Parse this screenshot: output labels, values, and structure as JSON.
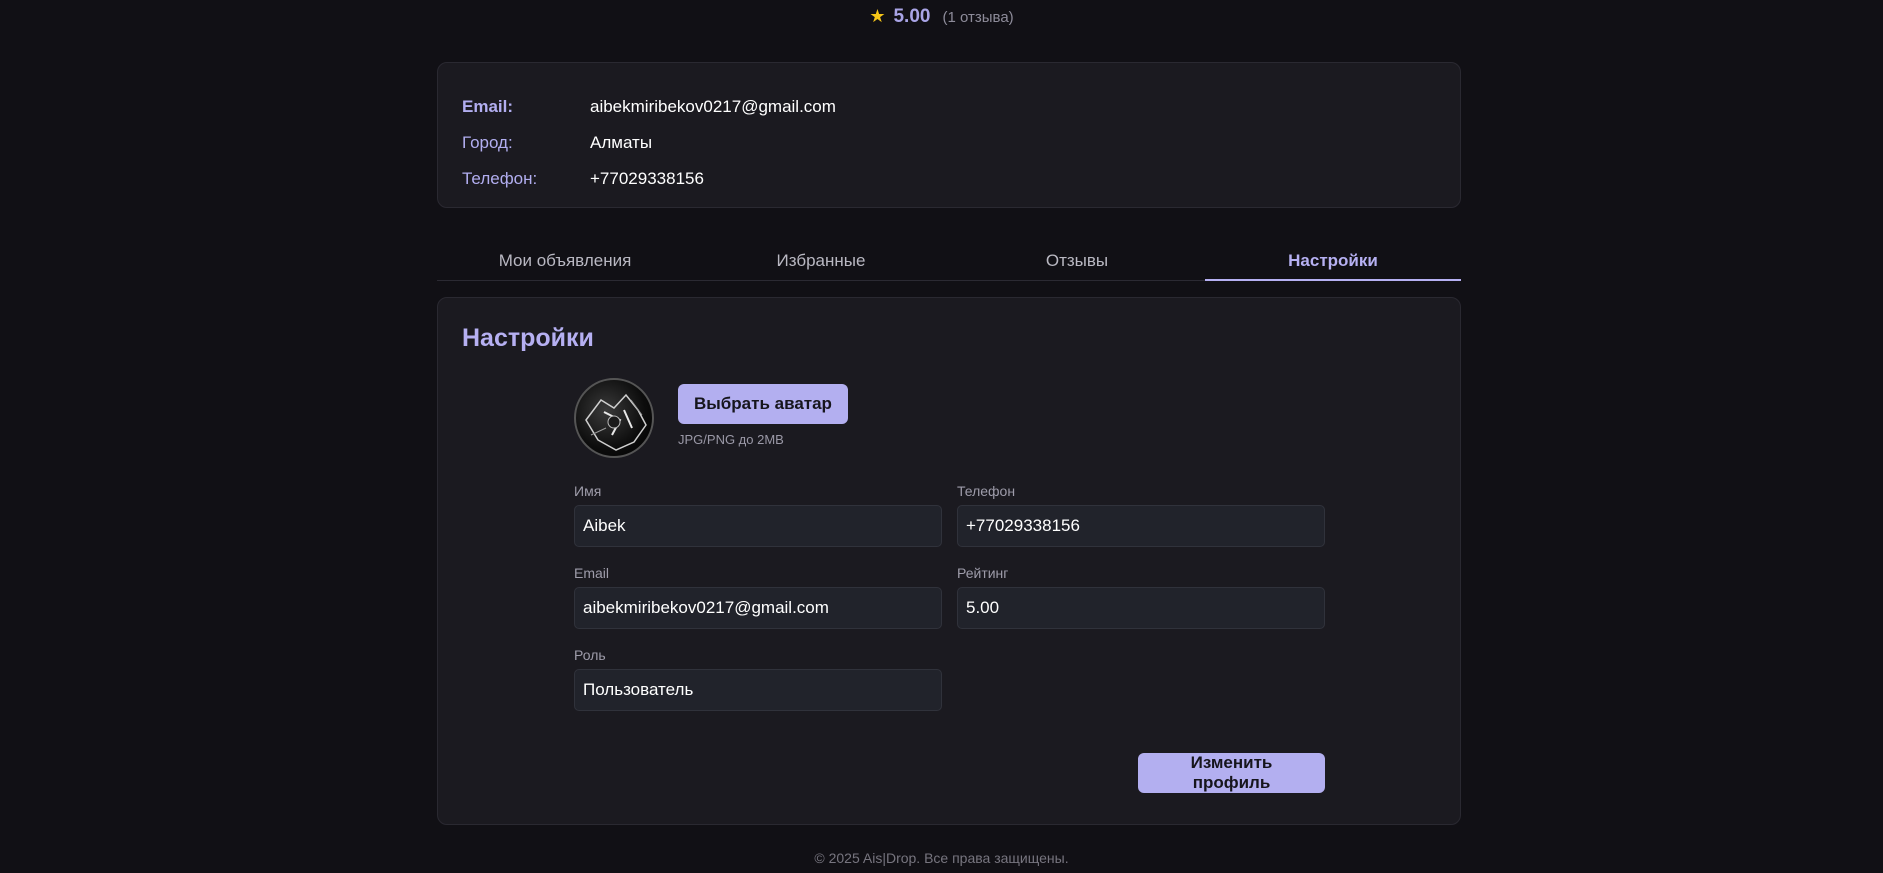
{
  "rating": {
    "star": "★",
    "value": "5.00",
    "count": "(1 отзыва)"
  },
  "info": [
    {
      "label": "Email:",
      "value": "aibekmiribekov0217@gmail.com"
    },
    {
      "label": "Город:",
      "value": "Алматы"
    },
    {
      "label": "Телефон:",
      "value": "+77029338156"
    }
  ],
  "tabs": [
    {
      "label": "Мои объявления",
      "active": false
    },
    {
      "label": "Избранные",
      "active": false
    },
    {
      "label": "Отзывы",
      "active": false
    },
    {
      "label": "Настройки",
      "active": true
    }
  ],
  "settings": {
    "title": "Настройки",
    "avatar_button": "Выбрать аватар",
    "avatar_hint": "JPG/PNG до 2MB",
    "fields": {
      "name": {
        "label": "Имя",
        "value": "Aibek"
      },
      "phone": {
        "label": "Телефон",
        "value": "+77029338156"
      },
      "email": {
        "label": "Email",
        "value": "aibekmiribekov0217@gmail.com"
      },
      "rating": {
        "label": "Рейтинг",
        "value": "5.00"
      },
      "role": {
        "label": "Роль",
        "value": "Пользователь"
      }
    },
    "save_button": "Изменить профиль"
  },
  "footer": "© 2025 Ais|Drop. Все права защищены.",
  "colors": {
    "background": "#111015",
    "accent": "#b3aff0",
    "card": "#1b1a20",
    "star": "#f5c518"
  }
}
